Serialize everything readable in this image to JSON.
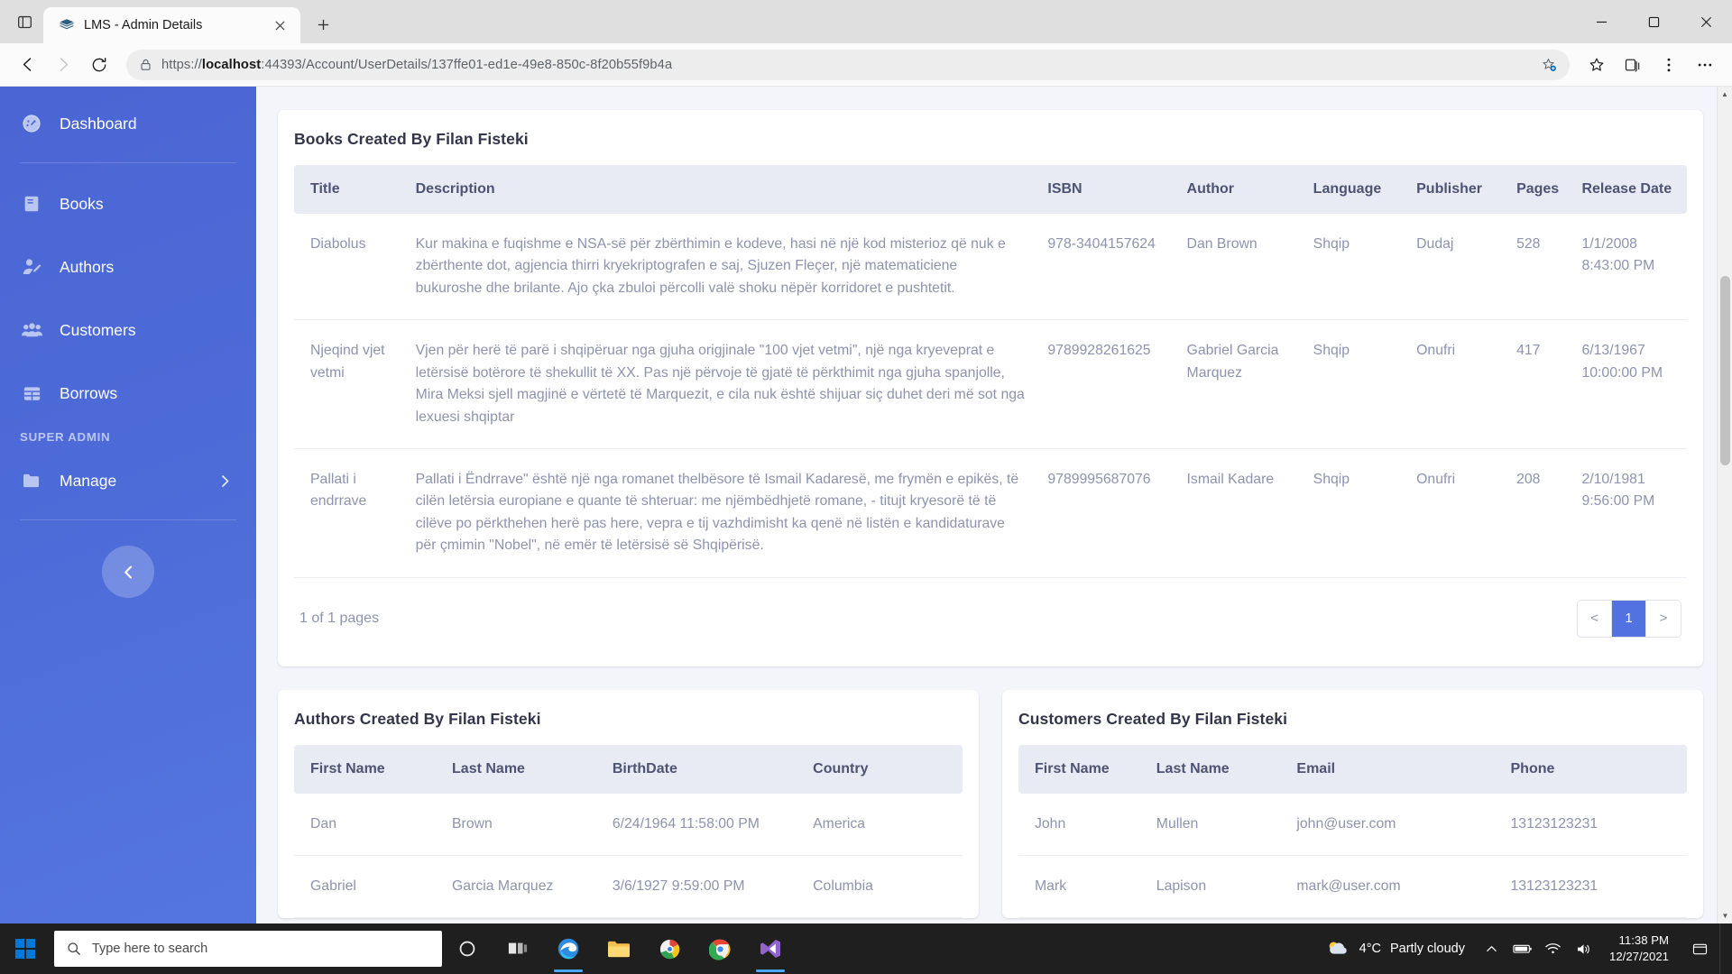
{
  "browser": {
    "tab": {
      "title": "LMS - Admin Details",
      "favicon": "books-stack-icon"
    },
    "new_tab_label": "+",
    "url_protocol": "https://",
    "url_host": "localhost",
    "url_rest": ":44393/Account/UserDetails/137ffe01-ed1e-49e8-850c-8f20b55f9b4a",
    "url_full": "https://localhost:44393/Account/UserDetails/137ffe01-ed1e-49e8-850c-8f20b55f9b4a"
  },
  "sidebar": {
    "items": [
      {
        "label": "Dashboard",
        "icon": "dashboard-gauge-icon"
      },
      {
        "label": "Books",
        "icon": "book-icon"
      },
      {
        "label": "Authors",
        "icon": "user-edit-icon"
      },
      {
        "label": "Customers",
        "icon": "users-group-icon"
      },
      {
        "label": "Borrows",
        "icon": "table-grid-icon"
      }
    ],
    "section_header": "SUPER ADMIN",
    "manage": {
      "label": "Manage",
      "icon": "folder-icon",
      "caret": "chevron-right-icon"
    },
    "collapse_icon": "chevron-left-icon",
    "accent": "#4d6bd8"
  },
  "books_panel": {
    "title": "Books Created By Filan Fisteki",
    "columns": [
      "Title",
      "Description",
      "ISBN",
      "Author",
      "Language",
      "Publisher",
      "Pages",
      "Release Date"
    ],
    "rows": [
      {
        "title": "Diabolus",
        "description": "Kur makina e fuqishme e NSA-së për zbërthimin e kodeve, hasi në një kod misterioz që nuk e zbërthente dot, agjencia thirri kryekriptografen e saj, Sjuzen Fleçer, një matematiciene bukuroshe dhe brilante. Ajo çka zbuloi përcolli valë shoku nëpër korridoret e pushtetit.",
        "isbn": "978-3404157624",
        "author": "Dan Brown",
        "language": "Shqip",
        "publisher": "Dudaj",
        "pages": "528",
        "release_date": "1/1/2008 8:43:00 PM"
      },
      {
        "title": "Njeqind vjet vetmi",
        "description": "Vjen për herë të parë i shqipëruar nga gjuha origjinale \"100 vjet vetmi\", një nga kryeveprat e letërsisë botërore të shekullit të XX. Pas një përvoje të gjatë të përkthimit nga gjuha spanjolle, Mira Meksi sjell magjinë e vërtetë të Marquezit, e cila nuk është shijuar siç duhet deri më sot nga lexuesi shqiptar",
        "isbn": "9789928261625",
        "author": "Gabriel Garcia Marquez",
        "language": "Shqip",
        "publisher": "Onufri",
        "pages": "417",
        "release_date": "6/13/1967 10:00:00 PM"
      },
      {
        "title": "Pallati i endrrave",
        "description": "Pallati i Ëndrrave\" është një nga romanet thelbësore të Ismail Kadaresë, me frymën e epikës, të cilën letërsia europiane e quante të shteruar: me njëmbëdhjetë romane, - titujt kryesorë të të cilëve po përkthehen herë pas here, vepra e tij vazhdimisht ka qenë në listën e kandidaturave për çmimin \"Nobel\", në emër të letërsisë së Shqipërisë.",
        "isbn": "9789995687076",
        "author": "Ismail Kadare",
        "language": "Shqip",
        "publisher": "Onufri",
        "pages": "208",
        "release_date": "2/10/1981 9:56:00 PM"
      }
    ],
    "pager": {
      "info": "1 of 1 pages",
      "prev": "<",
      "next": ">",
      "pages": [
        "1"
      ],
      "active_page": "1"
    }
  },
  "authors_panel": {
    "title": "Authors Created By Filan Fisteki",
    "columns": [
      "First Name",
      "Last Name",
      "BirthDate",
      "Country"
    ],
    "rows": [
      {
        "first_name": "Dan",
        "last_name": "Brown",
        "birthdate": "6/24/1964 11:58:00 PM",
        "country": "America"
      },
      {
        "first_name": "Gabriel",
        "last_name": "Garcia Marquez",
        "birthdate": "3/6/1927 9:59:00 PM",
        "country": "Columbia"
      }
    ]
  },
  "customers_panel": {
    "title": "Customers Created By Filan Fisteki",
    "columns": [
      "First Name",
      "Last Name",
      "Email",
      "Phone"
    ],
    "rows": [
      {
        "first_name": "John",
        "last_name": "Mullen",
        "email": "john@user.com",
        "phone": "13123123231"
      },
      {
        "first_name": "Mark",
        "last_name": "Lapison",
        "email": "mark@user.com",
        "phone": "13123123231"
      }
    ]
  },
  "taskbar": {
    "search_placeholder": "Type here to search",
    "weather_temp": "4°C",
    "weather_desc": "Partly cloudy",
    "time": "11:38 PM",
    "date": "12/27/2021"
  }
}
